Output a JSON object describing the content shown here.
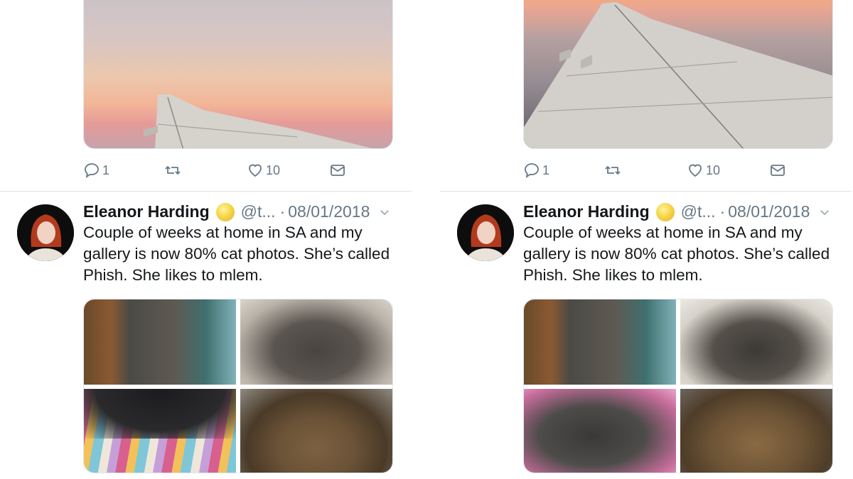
{
  "columns": [
    {
      "id": "left",
      "previous_tweet": {
        "replies": "1",
        "likes": "10"
      },
      "tweet": {
        "name": "Eleanor Harding",
        "handle": "@t...",
        "separator": "·",
        "date": "08/01/2018",
        "text": "Couple of weeks at home in SA and my gallery is now 80% cat photos. She’s called Phish. She likes to mlem."
      }
    },
    {
      "id": "right",
      "previous_tweet": {
        "replies": "1",
        "likes": "10"
      },
      "tweet": {
        "name": "Eleanor Harding",
        "handle": "@t...",
        "separator": "·",
        "date": "08/01/2018",
        "text": "Couple of weeks at home in SA and my gallery is now 80% cat photos. She’s called Phish. She likes to mlem."
      }
    }
  ],
  "icons": {
    "reply": "reply-icon",
    "retweet": "retweet-icon",
    "like": "heart-icon",
    "message": "envelope-icon",
    "verified_emoji": "moon-emoji-icon",
    "more": "chevron-down-icon"
  },
  "colors": {
    "text": "#14171a",
    "secondary": "#657786",
    "divider": "#dfe3e6"
  }
}
